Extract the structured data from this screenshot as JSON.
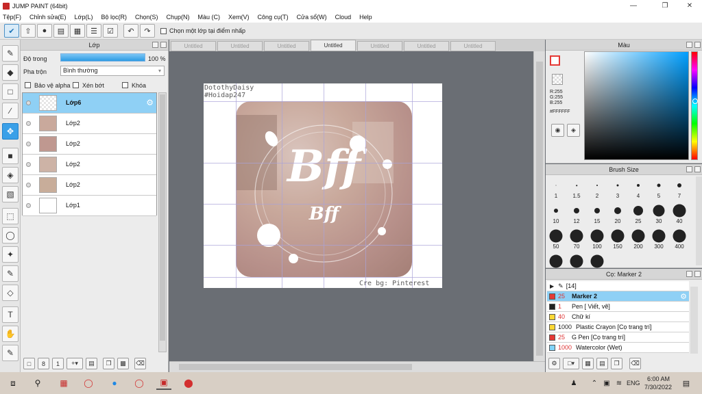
{
  "window": {
    "title": "JUMP PAINT (64bit)"
  },
  "menu": [
    "Tệp(F)",
    "Chỉnh sửa(E)",
    "Lớp(L)",
    "Bộ lọc(R)",
    "Chọn(S)",
    "Chụp(N)",
    "Màu (C)",
    "Xem(V)",
    "Công cụ(T)",
    "Cửa sổ(W)",
    "Cloud",
    "Help"
  ],
  "toolbar": {
    "select_point_label": "Chọn một lớp tại điểm nhấp"
  },
  "layer_panel": {
    "title": "Lớp",
    "opacity_label": "Độ trong",
    "opacity_value": "100 %",
    "blend_label": "Pha trộn",
    "blend_value": "Bình thường",
    "protect_alpha": "Bảo vệ alpha",
    "clip": "Xén bớt",
    "lock": "Khóa",
    "layers": [
      {
        "name": "Lớp6",
        "selected": true
      },
      {
        "name": "Lớp2"
      },
      {
        "name": "Lớp2"
      },
      {
        "name": "Lớp2"
      },
      {
        "name": "Lớp2"
      },
      {
        "name": "Lớp1"
      }
    ]
  },
  "tabs": [
    "Untitled",
    "Untitled",
    "Untitled",
    "Untitled",
    "Untitled",
    "Untitled",
    "Untitled"
  ],
  "canvas": {
    "top_text_1": "DotothyDaisy",
    "top_text_2": "#Hoidap247",
    "title_main": "Bff",
    "title_sub": "Bff",
    "credit": "Cre bg: Pinterest"
  },
  "color_panel": {
    "title": "Màu",
    "r": "R:255",
    "g": "G:255",
    "b": "B:255",
    "hex": "#FFFFFF",
    "current_color": "#ffffff"
  },
  "brush_panel": {
    "title": "Brush Size",
    "sizes": [
      "1",
      "1.5",
      "2",
      "3",
      "4",
      "5",
      "7",
      "10",
      "12",
      "15",
      "20",
      "25",
      "30",
      "40",
      "50",
      "70",
      "100",
      "150",
      "200",
      "300",
      "400",
      "",
      "",
      ""
    ]
  },
  "marker_panel": {
    "title": "Cọ: Marker 2",
    "group": "[14]",
    "items": [
      {
        "size": "25",
        "name": "Marker 2",
        "color": "#e53935",
        "selected": true
      },
      {
        "size": "1",
        "name": "Pen [ Viết, vẽ]",
        "color": "#212121"
      },
      {
        "size": "40",
        "name": "Chữ kí",
        "color": "#fdd835"
      },
      {
        "size": "1000",
        "name": "Plastic Crayon [Cọ trang trí]",
        "color": "#fdd835"
      },
      {
        "size": "25",
        "name": "G Pen [Cọ trang trí]",
        "color": "#e53935"
      },
      {
        "size": "1000",
        "name": "Watercolor (Wet)",
        "color": "#81d4fa"
      }
    ]
  },
  "taskbar": {
    "lang": "ENG",
    "time": "6:00 AM",
    "date": "7/30/2022"
  }
}
